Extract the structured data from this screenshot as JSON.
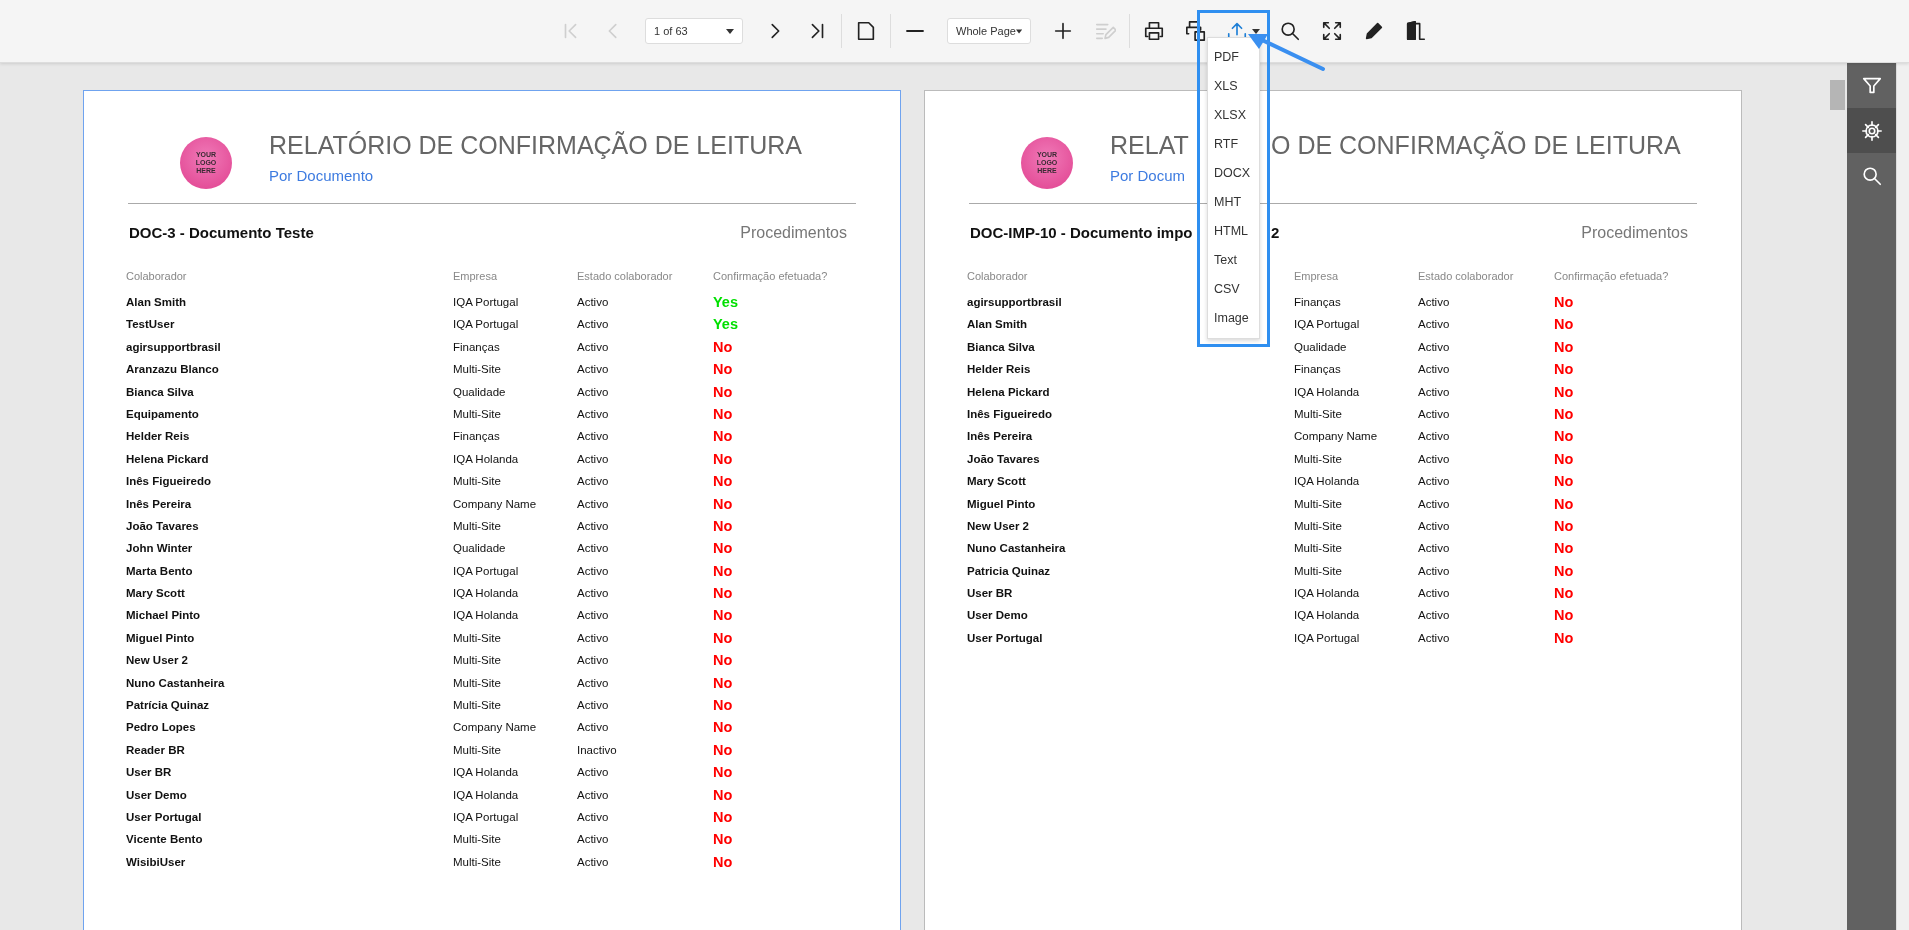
{
  "toolbar": {
    "groups": [
      [
        {
          "kind": "first",
          "disabled": true
        },
        {
          "kind": "previous",
          "disabled": true
        },
        {
          "kind": "pages",
          "value": "1 of 63"
        },
        {
          "kind": "next",
          "disabled": false
        },
        {
          "kind": "last",
          "disabled": false
        }
      ],
      [
        {
          "kind": "layout",
          "disabled": false
        }
      ],
      [
        {
          "kind": "zoomout",
          "disabled": false
        },
        {
          "kind": "zoom",
          "value": "Whole Page"
        },
        {
          "kind": "zoomin",
          "disabled": false
        },
        {
          "kind": "editing",
          "disabled": true
        }
      ],
      [
        {
          "kind": "print",
          "disabled": false
        },
        {
          "kind": "printpage",
          "disabled": false
        },
        {
          "kind": "export",
          "disabled": false,
          "expanded": true,
          "menu": [
            "PDF",
            "XLS",
            "XLSX",
            "RTF",
            "DOCX",
            "MHT",
            "HTML",
            "Text",
            "CSV",
            "Image"
          ]
        },
        {
          "kind": "search",
          "disabled": false
        },
        {
          "kind": "fullscreen",
          "disabled": false
        },
        {
          "kind": "pencil",
          "disabled": false
        },
        {
          "kind": "exit",
          "disabled": false
        }
      ]
    ]
  },
  "side_panel": [
    {
      "kind": "filter",
      "selected": false
    },
    {
      "kind": "settings",
      "selected": true
    },
    {
      "kind": "search",
      "selected": false
    }
  ],
  "pages": [
    {
      "selected": true,
      "logo": [
        "YOUR",
        "LOGO",
        "HERE"
      ],
      "title_parts": [
        "RELATÓRIO DE CONFIRMAÇÃO DE LEITURA"
      ],
      "subtitle": "Por Documento",
      "doc_title_parts": [
        "DOC-3 - Documento Teste"
      ],
      "category": "Procedimentos",
      "columns": [
        "Colaborador",
        "Empresa",
        "Estado colaborador",
        "Confirmação efetuada?"
      ],
      "rows": [
        {
          "name": "Alan Smith",
          "company": "IQA Portugal",
          "state": "Activo",
          "confirmation": "Yes",
          "confirmed": true
        },
        {
          "name": "TestUser",
          "company": "IQA Portugal",
          "state": "Activo",
          "confirmation": "Yes",
          "confirmed": true
        },
        {
          "name": "agirsupportbrasil",
          "company": "Finanças",
          "state": "Activo",
          "confirmation": "No",
          "confirmed": false
        },
        {
          "name": "Aranzazu Blanco",
          "company": "Multi-Site",
          "state": "Activo",
          "confirmation": "No",
          "confirmed": false
        },
        {
          "name": "Bianca Silva",
          "company": "Qualidade",
          "state": "Activo",
          "confirmation": "No",
          "confirmed": false
        },
        {
          "name": "Equipamento",
          "company": "Multi-Site",
          "state": "Activo",
          "confirmation": "No",
          "confirmed": false
        },
        {
          "name": "Helder Reis",
          "company": "Finanças",
          "state": "Activo",
          "confirmation": "No",
          "confirmed": false
        },
        {
          "name": "Helena Pickard",
          "company": "IQA Holanda",
          "state": "Activo",
          "confirmation": "No",
          "confirmed": false
        },
        {
          "name": "Inês Figueiredo",
          "company": "Multi-Site",
          "state": "Activo",
          "confirmation": "No",
          "confirmed": false
        },
        {
          "name": "Inês Pereira",
          "company": "Company Name",
          "state": "Activo",
          "confirmation": "No",
          "confirmed": false
        },
        {
          "name": "João Tavares",
          "company": "Multi-Site",
          "state": "Activo",
          "confirmation": "No",
          "confirmed": false
        },
        {
          "name": "John Winter",
          "company": "Qualidade",
          "state": "Activo",
          "confirmation": "No",
          "confirmed": false
        },
        {
          "name": "Marta Bento",
          "company": "IQA Portugal",
          "state": "Activo",
          "confirmation": "No",
          "confirmed": false
        },
        {
          "name": "Mary Scott",
          "company": "IQA Holanda",
          "state": "Activo",
          "confirmation": "No",
          "confirmed": false
        },
        {
          "name": "Michael Pinto",
          "company": "IQA Holanda",
          "state": "Activo",
          "confirmation": "No",
          "confirmed": false
        },
        {
          "name": "Miguel Pinto",
          "company": "Multi-Site",
          "state": "Activo",
          "confirmation": "No",
          "confirmed": false
        },
        {
          "name": "New User 2",
          "company": "Multi-Site",
          "state": "Activo",
          "confirmation": "No",
          "confirmed": false
        },
        {
          "name": "Nuno Castanheira",
          "company": "Multi-Site",
          "state": "Activo",
          "confirmation": "No",
          "confirmed": false
        },
        {
          "name": "Patrícia Quinaz",
          "company": "Multi-Site",
          "state": "Activo",
          "confirmation": "No",
          "confirmed": false
        },
        {
          "name": "Pedro Lopes",
          "company": "Company Name",
          "state": "Activo",
          "confirmation": "No",
          "confirmed": false
        },
        {
          "name": "Reader BR",
          "company": "Multi-Site",
          "state": "Inactivo",
          "confirmation": "No",
          "confirmed": false
        },
        {
          "name": "User BR",
          "company": "IQA Holanda",
          "state": "Activo",
          "confirmation": "No",
          "confirmed": false
        },
        {
          "name": "User Demo",
          "company": "IQA Holanda",
          "state": "Activo",
          "confirmation": "No",
          "confirmed": false
        },
        {
          "name": "User Portugal",
          "company": "IQA Portugal",
          "state": "Activo",
          "confirmation": "No",
          "confirmed": false
        },
        {
          "name": "Vicente Bento",
          "company": "Multi-Site",
          "state": "Activo",
          "confirmation": "No",
          "confirmed": false
        },
        {
          "name": "WisibiUser",
          "company": "Multi-Site",
          "state": "Activo",
          "confirmation": "No",
          "confirmed": false
        }
      ]
    },
    {
      "selected": false,
      "logo": [
        "YOUR",
        "LOGO",
        "HERE"
      ],
      "title_parts": [
        "RELAT",
        "O DE CONFIRMAÇÃO DE LEITURA"
      ],
      "subtitle": "Por Docum",
      "doc_title_parts": [
        "DOC-IMP-10 - Documento impo",
        "2"
      ],
      "category": "Procedimentos",
      "columns": [
        "Colaborador",
        "Empresa",
        "Estado colaborador",
        "Confirmação efetuada?"
      ],
      "rows": [
        {
          "name": "agirsupportbrasil",
          "company": "Finanças",
          "state": "Activo",
          "confirmation": "No",
          "confirmed": false
        },
        {
          "name": "Alan Smith",
          "company": "IQA Portugal",
          "state": "Activo",
          "confirmation": "No",
          "confirmed": false
        },
        {
          "name": "Bianca Silva",
          "company": "Qualidade",
          "state": "Activo",
          "confirmation": "No",
          "confirmed": false
        },
        {
          "name": "Helder Reis",
          "company": "Finanças",
          "state": "Activo",
          "confirmation": "No",
          "confirmed": false
        },
        {
          "name": "Helena Pickard",
          "company": "IQA Holanda",
          "state": "Activo",
          "confirmation": "No",
          "confirmed": false
        },
        {
          "name": "Inês Figueiredo",
          "company": "Multi-Site",
          "state": "Activo",
          "confirmation": "No",
          "confirmed": false
        },
        {
          "name": "Inês Pereira",
          "company": "Company Name",
          "state": "Activo",
          "confirmation": "No",
          "confirmed": false
        },
        {
          "name": "João Tavares",
          "company": "Multi-Site",
          "state": "Activo",
          "confirmation": "No",
          "confirmed": false
        },
        {
          "name": "Mary Scott",
          "company": "IQA Holanda",
          "state": "Activo",
          "confirmation": "No",
          "confirmed": false
        },
        {
          "name": "Miguel Pinto",
          "company": "Multi-Site",
          "state": "Activo",
          "confirmation": "No",
          "confirmed": false
        },
        {
          "name": "New User 2",
          "company": "Multi-Site",
          "state": "Activo",
          "confirmation": "No",
          "confirmed": false
        },
        {
          "name": "Nuno Castanheira",
          "company": "Multi-Site",
          "state": "Activo",
          "confirmation": "No",
          "confirmed": false
        },
        {
          "name": "Patricia Quinaz",
          "company": "Multi-Site",
          "state": "Activo",
          "confirmation": "No",
          "confirmed": false
        },
        {
          "name": "User BR",
          "company": "IQA Holanda",
          "state": "Activo",
          "confirmation": "No",
          "confirmed": false
        },
        {
          "name": "User Demo",
          "company": "IQA Holanda",
          "state": "Activo",
          "confirmation": "No",
          "confirmed": false
        },
        {
          "name": "User Portugal",
          "company": "IQA Portugal",
          "state": "Activo",
          "confirmation": "No",
          "confirmed": false
        }
      ]
    }
  ]
}
